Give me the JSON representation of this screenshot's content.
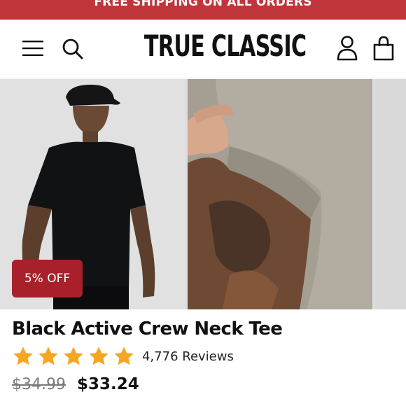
{
  "promo": {
    "text": "FREE SHIPPING ON ALL ORDERS"
  },
  "header": {
    "brand": "TRUE CLASSIC"
  },
  "icons": {
    "menu": "hamburger-menu-icon",
    "search": "search-icon",
    "account": "user-account-icon",
    "bag": "shopping-bag-icon",
    "star": "star-icon"
  },
  "gallery": {
    "images": [
      {
        "alt": "Model wearing black crew neck tee and black cap"
      },
      {
        "alt": "Close-up of tan tee sleeve on tattooed arm"
      },
      {
        "alt": "Partial product image"
      }
    ]
  },
  "badge": {
    "text": "5% OFF"
  },
  "product": {
    "title": "Black Active Crew Neck Tee",
    "rating": 5,
    "reviews": "4,776 Reviews",
    "price_original": "$34.99",
    "price_sale": "$33.24"
  },
  "colors": {
    "promo_bg": "#c0353a",
    "badge_bg": "#a8202a",
    "star": "#f5a623",
    "text": "#111111"
  }
}
